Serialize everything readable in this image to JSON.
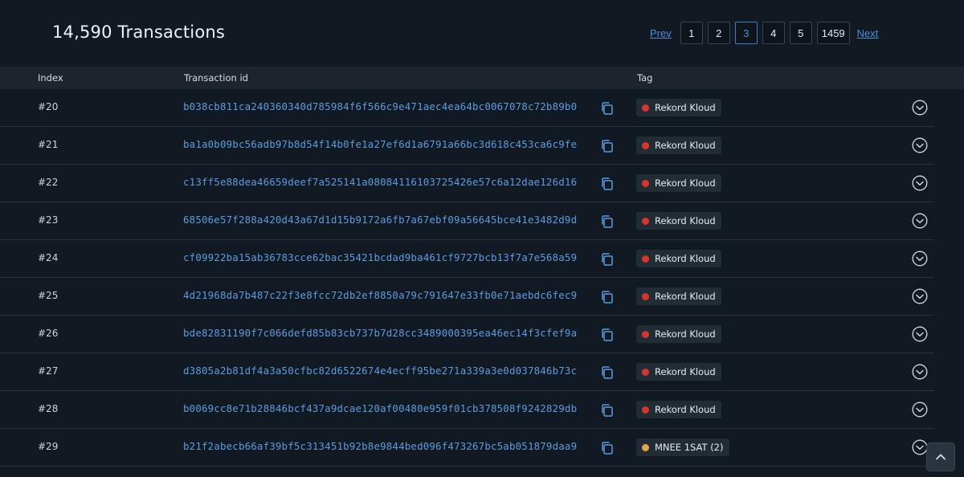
{
  "page": {
    "title": "14,590 Transactions"
  },
  "pagination": {
    "prev_label": "Prev",
    "next_label": "Next",
    "pages": [
      "1",
      "2",
      "3",
      "4",
      "5",
      "1459"
    ],
    "active_page": "3"
  },
  "table": {
    "headers": {
      "index": "Index",
      "txid": "Transaction id",
      "tag": "Tag"
    },
    "rows": [
      {
        "index": "#20",
        "txid": "b038cb811ca240360340d785984f6f566c9e471aec4ea64bc0067078c72b89b0",
        "tag": "Rekord Kloud",
        "tag_color": "#d9342b"
      },
      {
        "index": "#21",
        "txid": "ba1a0b09bc56adb97b8d54f14b0fe1a27ef6d1a6791a66bc3d618c453ca6c9fe",
        "tag": "Rekord Kloud",
        "tag_color": "#d9342b"
      },
      {
        "index": "#22",
        "txid": "c13ff5e88dea46659deef7a525141a08084116103725426e57c6a12dae126d16",
        "tag": "Rekord Kloud",
        "tag_color": "#d9342b"
      },
      {
        "index": "#23",
        "txid": "68506e57f288a420d43a67d1d15b9172a6fb7a67ebf09a56645bce41e3482d9d",
        "tag": "Rekord Kloud",
        "tag_color": "#d9342b"
      },
      {
        "index": "#24",
        "txid": "cf09922ba15ab36783cce62bac35421bcdad9ba461cf9727bcb13f7a7e568a59",
        "tag": "Rekord Kloud",
        "tag_color": "#d9342b"
      },
      {
        "index": "#25",
        "txid": "4d21968da7b487c22f3e8fcc72db2ef8850a79c791647e33fb0e71aebdc6fec9",
        "tag": "Rekord Kloud",
        "tag_color": "#d9342b"
      },
      {
        "index": "#26",
        "txid": "bde82831190f7c066defd85b83cb737b7d28cc3489000395ea46ec14f3cfef9a",
        "tag": "Rekord Kloud",
        "tag_color": "#d9342b"
      },
      {
        "index": "#27",
        "txid": "d3805a2b81df4a3a50cfbc82d6522674e4ecff95be271a339a3e0d037846b73c",
        "tag": "Rekord Kloud",
        "tag_color": "#d9342b"
      },
      {
        "index": "#28",
        "txid": "b0069cc8e71b28846bcf437a9dcae120af00480e959f01cb378508f9242829db",
        "tag": "Rekord Kloud",
        "tag_color": "#d9342b"
      },
      {
        "index": "#29",
        "txid": "b21f2abecb66af39bf5c313451b92b8e9844bed096f473267bc5ab051879daa9",
        "tag": "MNEE 1SAT (2)",
        "tag_color": "#e0a84a"
      }
    ]
  },
  "icons": {
    "copy": "copy-icon",
    "expand": "chevron-down-circle-icon",
    "scroll_top": "chevron-up-icon"
  }
}
